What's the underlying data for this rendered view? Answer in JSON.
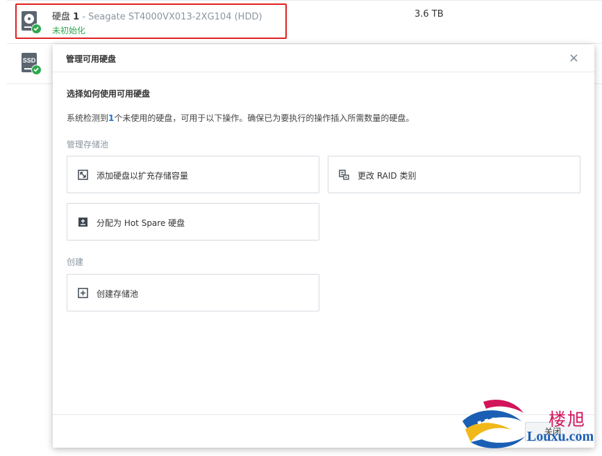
{
  "disk_list": {
    "disk1": {
      "name_prefix": "硬盘",
      "number": "1",
      "model": " - Seagate ST4000VX013-2XG104 (HDD)",
      "status": "未初始化",
      "size": "3.6 TB"
    },
    "disk2": {
      "type_label": "SSD"
    }
  },
  "dialog": {
    "title": "管理可用硬盘",
    "close_icon": "×",
    "heading": "选择如何使用可用硬盘",
    "desc_before": "系统检测到",
    "desc_count": "1",
    "desc_after": "个未使用的硬盘，可用于以下操作。确保已为要执行的操作插入所需数量的硬盘。",
    "group_storage_pool": "管理存储池",
    "group_create": "创建",
    "options": {
      "add_disk": "添加硬盘以扩充存储容量",
      "change_raid": "更改 RAID 类别",
      "hot_spare": "分配为 Hot Spare 硬盘",
      "create_pool": "创建存储池"
    },
    "footer_close": "关闭"
  },
  "watermark": {
    "cn": "楼旭",
    "en": "Louxu.com"
  },
  "colors": {
    "highlight": "#e02020",
    "status_green": "#2fa84f",
    "accent_blue": "#1c6fd6"
  }
}
